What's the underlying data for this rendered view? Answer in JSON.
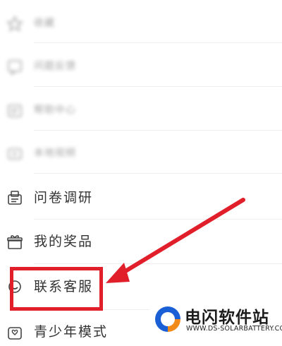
{
  "menu": {
    "items": [
      {
        "label": "收藏",
        "icon": "star-icon",
        "blurred": true
      },
      {
        "label": "问题反馈",
        "icon": "feedback-icon",
        "blurred": true
      },
      {
        "label": "帮助中心",
        "icon": "help-icon",
        "blurred": true
      },
      {
        "label": "本地视频",
        "icon": "video-icon",
        "blurred": true
      },
      {
        "label": "问卷调研",
        "icon": "survey-icon",
        "blurred": false
      },
      {
        "label": "我的奖品",
        "icon": "gift-icon",
        "blurred": false
      },
      {
        "label": "联系客服",
        "icon": "customer-service-icon",
        "blurred": false
      },
      {
        "label": "青少年模式",
        "icon": "teen-mode-icon",
        "blurred": false
      }
    ]
  },
  "annotation": {
    "highlight_color": "#e01f2b"
  },
  "watermark": {
    "title": "电闪软件站",
    "url": "WWW.DS-SOLARBATTERY.COM",
    "colors": {
      "blue": "#1a5fd6",
      "orange": "#f28a1a"
    }
  }
}
